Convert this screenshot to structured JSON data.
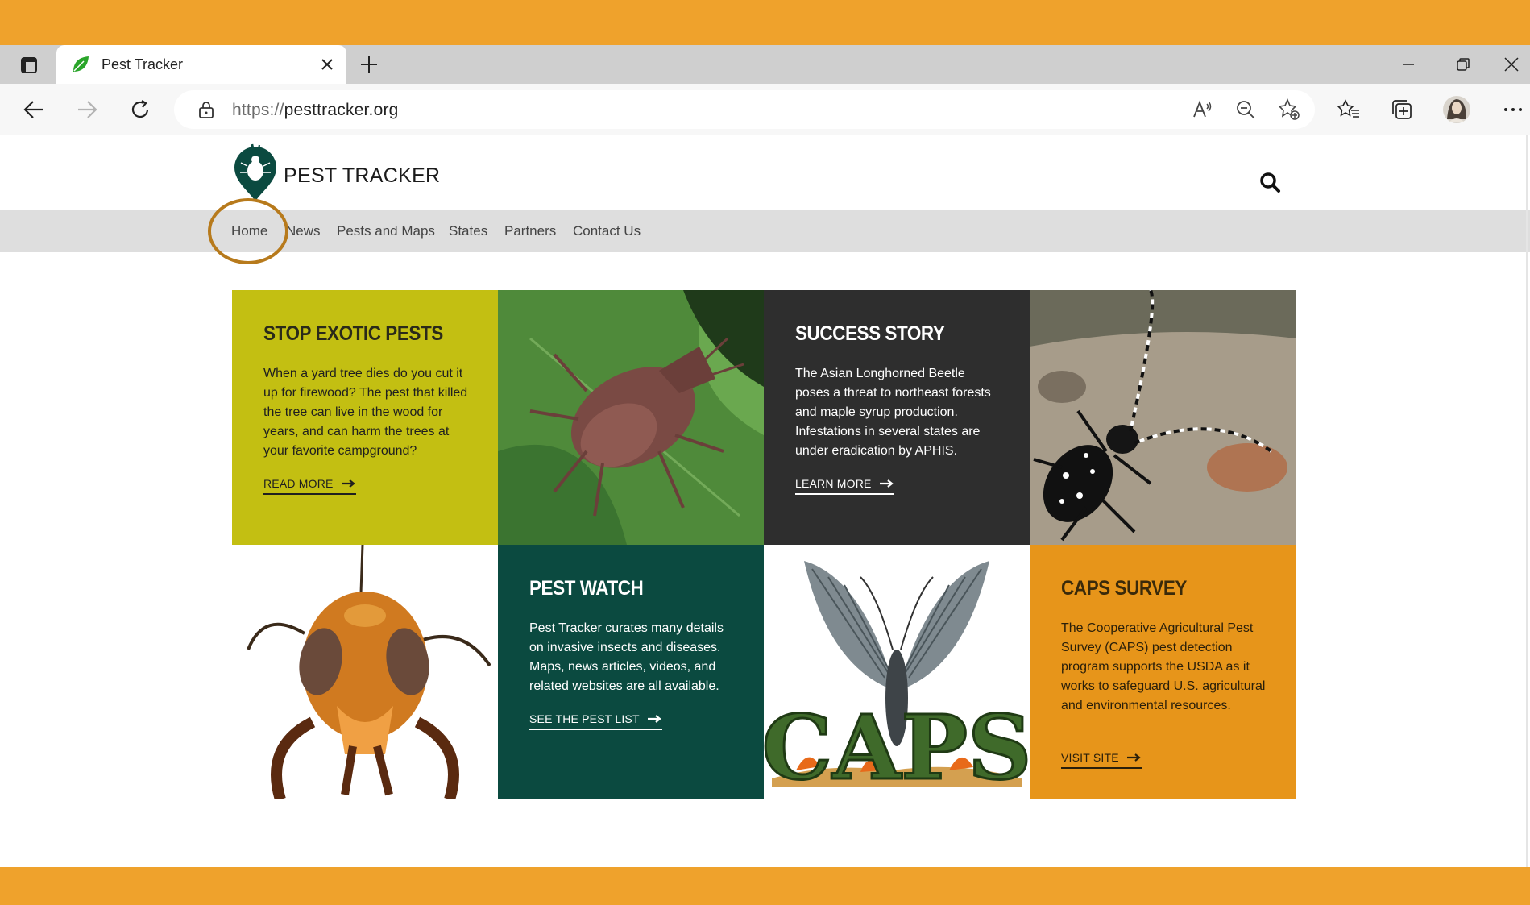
{
  "browser": {
    "tab_title": "Pest Tracker",
    "url_scheme": "https://",
    "url_host": "pesttracker.org"
  },
  "site": {
    "logo_text": "PEST TRACKER",
    "nav": [
      "Home",
      "News",
      "Pests and Maps",
      "States",
      "Partners",
      "Contact Us"
    ]
  },
  "cards": {
    "stop_exotic": {
      "title": "STOP EXOTIC PESTS",
      "body": "When a yard tree dies do you cut it up for firewood? The pest that killed the tree can live in the wood for years, and can harm the trees at your favorite campground?",
      "cta": "READ MORE"
    },
    "success_story": {
      "title": "SUCCESS STORY",
      "body": "The Asian Longhorned Beetle poses a threat to northeast forests and maple syrup production. Infestations in several states are under eradication by APHIS.",
      "cta": "LEARN MORE"
    },
    "pest_watch": {
      "title": "PEST WATCH",
      "body": "Pest Tracker curates many details on invasive insects and diseases. Maps, news articles, videos, and related websites are all available.",
      "cta": "SEE THE PEST LIST"
    },
    "caps_survey": {
      "title": "CAPS SURVEY",
      "body": "The Cooperative Agricultural Pest Survey (CAPS) pest detection program supports the USDA as it works to safeguard U.S. agricultural and environmental resources.",
      "cta": "VISIT SITE"
    },
    "caps_logo_text": "CAPS"
  },
  "colors": {
    "frame_orange": "#efa22c",
    "olive": "#c3bf12",
    "charcoal": "#2e2e2e",
    "forest_green": "#0b4a40",
    "caps_orange": "#e7951a",
    "highlight_ring": "#b77a1c"
  },
  "icons": [
    "tab-actions-icon",
    "leaf-favicon-icon",
    "close-icon",
    "plus-icon",
    "minimize-icon",
    "restore-icon",
    "window-close-icon",
    "back-icon",
    "forward-icon",
    "refresh-icon",
    "lock-icon",
    "read-aloud-icon",
    "zoom-out-icon",
    "add-favorite-icon",
    "favorites-icon",
    "collections-icon",
    "profile-avatar",
    "more-icon",
    "search-icon",
    "arrow-right-icon"
  ]
}
